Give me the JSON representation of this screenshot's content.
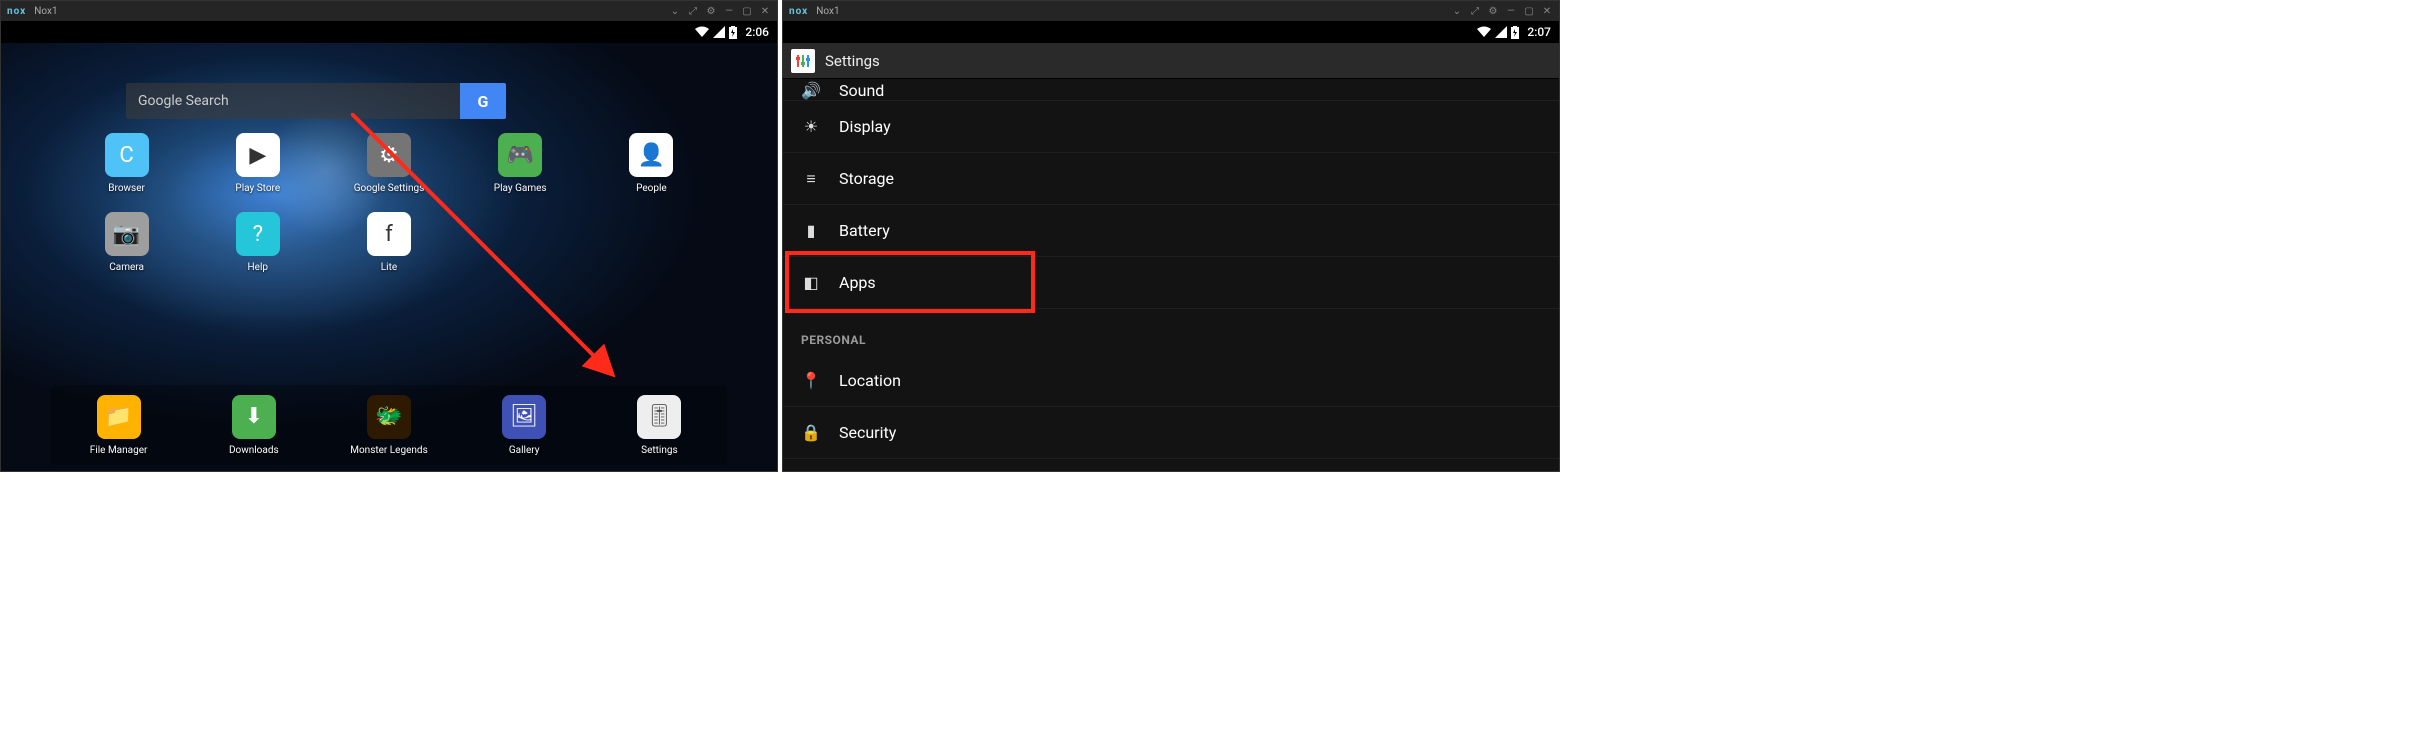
{
  "left": {
    "titlebar": {
      "logo": "nox",
      "title": "Nox1"
    },
    "status": {
      "time": "2:06"
    },
    "search": {
      "placeholder": "Google Search",
      "button": "G"
    },
    "grid": [
      {
        "name": "browser",
        "label": "Browser",
        "bg": "#4fc3f7",
        "glyph": "C"
      },
      {
        "name": "play-store",
        "label": "Play Store",
        "bg": "#ffffff",
        "glyph": "▶"
      },
      {
        "name": "google-settings",
        "label": "Google Settings",
        "bg": "#757575",
        "glyph": "⚙"
      },
      {
        "name": "play-games",
        "label": "Play Games",
        "bg": "#4caf50",
        "glyph": "🎮"
      },
      {
        "name": "people",
        "label": "People",
        "bg": "#ffffff",
        "glyph": "👤"
      },
      {
        "name": "camera",
        "label": "Camera",
        "bg": "#9e9e9e",
        "glyph": "📷"
      },
      {
        "name": "help",
        "label": "Help",
        "bg": "#26c6da",
        "glyph": "?"
      },
      {
        "name": "lite",
        "label": "Lite",
        "bg": "#ffffff",
        "glyph": "f"
      }
    ],
    "dock": [
      {
        "name": "file-manager",
        "label": "File Manager",
        "bg": "#ffb300",
        "glyph": "📁"
      },
      {
        "name": "downloads",
        "label": "Downloads",
        "bg": "#4caf50",
        "glyph": "⬇"
      },
      {
        "name": "monster-legends",
        "label": "Monster Legends",
        "bg": "#2e1a00",
        "glyph": "🐲"
      },
      {
        "name": "gallery",
        "label": "Gallery",
        "bg": "#3f51b5",
        "glyph": "🖼"
      },
      {
        "name": "settings",
        "label": "Settings",
        "bg": "#eeeeee",
        "glyph": "🎚"
      }
    ]
  },
  "right": {
    "titlebar": {
      "logo": "nox",
      "title": "Nox1"
    },
    "status": {
      "time": "2:07"
    },
    "headTitle": "Settings",
    "items": [
      {
        "name": "sound",
        "label": "Sound",
        "icon": "🔊",
        "partial": true
      },
      {
        "name": "display",
        "label": "Display",
        "icon": "☀"
      },
      {
        "name": "storage",
        "label": "Storage",
        "icon": "≡"
      },
      {
        "name": "battery",
        "label": "Battery",
        "icon": "▮"
      },
      {
        "name": "apps",
        "label": "Apps",
        "icon": "◧",
        "highlighted": true
      }
    ],
    "sectionPersonal": "PERSONAL",
    "personal": [
      {
        "name": "location",
        "label": "Location",
        "icon": "📍"
      },
      {
        "name": "security",
        "label": "Security",
        "icon": "🔒"
      }
    ]
  }
}
